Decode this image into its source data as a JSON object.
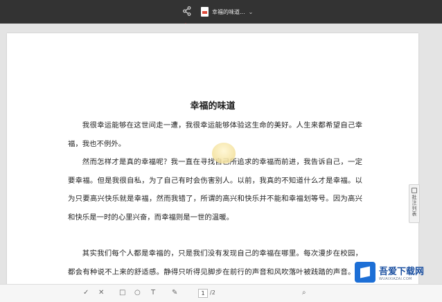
{
  "topbar": {
    "doc_title": "幸福的味道..."
  },
  "document": {
    "title": "幸福的味道",
    "paragraphs": [
      "我很幸运能够在这世间走一遭，我很幸运能够体验这生命的美好。人生来都希望自己幸福，我也不例外。",
      "然而怎样才是真的幸福呢？我一直在寻找自己所追求的幸福而前进，我告诉自己，一定要幸福。但是我很自私，为了自己有时会伤害别人。以前，我真的不知道什么才是幸福。以为只要高兴快乐就是幸福，然而我错了，所谓的高兴和快乐并不能和幸福划等号。因为高兴和快乐是一时的心里兴奋，而幸福则是一世的温暖。",
      "其实我们每个人都是幸福的，只是我们没有发现自己的幸福在哪里。每次漫步在校园，都会有种说不上来的舒适感。静得只听得见脚步在前行的声音和风吹落叶被践踏的声音。身旁依旧是那熟悉的身影，阳光照耀在我们每个人的脸上"
    ]
  },
  "annotation_tab": {
    "label": "批注列表"
  },
  "bottombar": {
    "tools": [
      "✓",
      "✕",
      "□",
      "○",
      "T",
      "✎",
      "⌕"
    ],
    "current_page": "1",
    "page_total": "/2"
  },
  "watermark": {
    "main": "吾爱下载网",
    "sub": "WUAIXIAZAI.COM"
  },
  "colors": {
    "topbar": "#333333",
    "canvas": "#e4e4e4",
    "annotation_arrow": "#d42a2a",
    "watermark_brand": "#1d6fd6"
  },
  "icons": {
    "share": "share-icon",
    "document": "pdf-file-icon",
    "dropdown": "chevron-down-icon"
  }
}
